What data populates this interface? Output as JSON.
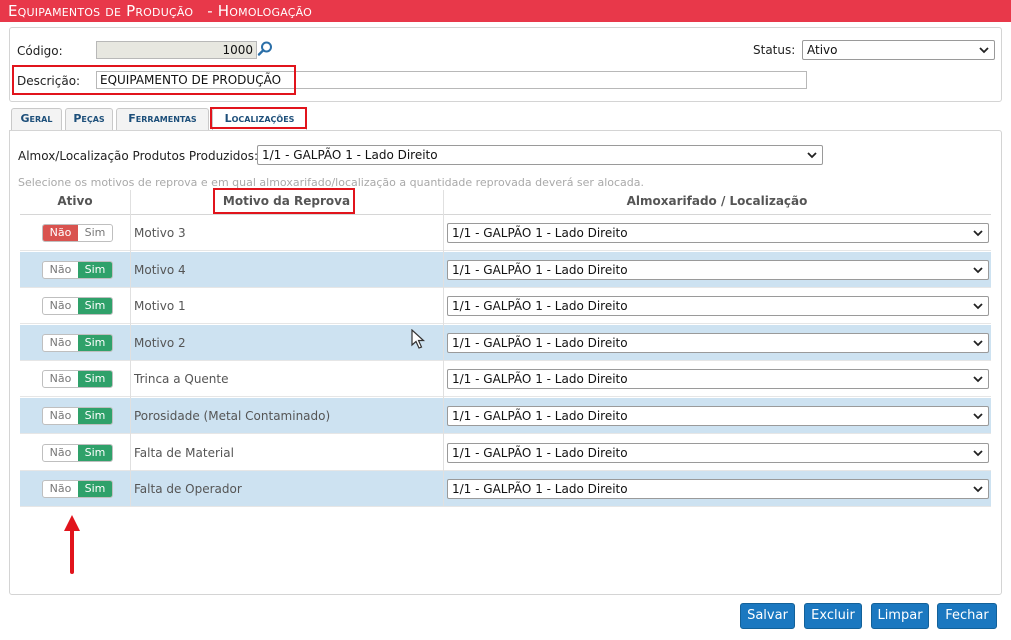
{
  "title": {
    "main": "Equipamentos de Produção",
    "sub": "- Homologação"
  },
  "form": {
    "codigo_label": "Código:",
    "codigo_value": "1000",
    "descricao_label": "Descrição:",
    "descricao_value": "EQUIPAMENTO DE PRODUÇÃO",
    "status_label": "Status:",
    "status_value": "Ativo"
  },
  "tabs": [
    {
      "label": "Geral",
      "active": false
    },
    {
      "label": "Peças",
      "active": false
    },
    {
      "label": "Ferramentas",
      "active": false
    },
    {
      "label": "Localizações",
      "active": true
    }
  ],
  "panel": {
    "almox_label": "Almox/Localização Produtos Produzidos:",
    "almox_value": "1/1 - GALPÃO 1 - Lado Direito",
    "hint": "Selecione os motivos de reprova e em qual almoxarifado/localização a quantidade reprovada deverá ser alocada."
  },
  "table": {
    "headers": {
      "ativo": "Ativo",
      "motivo": "Motivo da Reprova",
      "almox": "Almoxarifado / Localização"
    },
    "toggle_labels": {
      "nao": "Não",
      "sim": "Sim"
    },
    "rows": [
      {
        "ativo": "Não",
        "motivo": "Motivo 3",
        "local": "1/1 - GALPÃO 1 - Lado Direito"
      },
      {
        "ativo": "Sim",
        "motivo": "Motivo 4",
        "local": "1/1 - GALPÃO 1 - Lado Direito"
      },
      {
        "ativo": "Sim",
        "motivo": "Motivo 1",
        "local": "1/1 - GALPÃO 1 - Lado Direito"
      },
      {
        "ativo": "Sim",
        "motivo": "Motivo 2",
        "local": "1/1 - GALPÃO 1 - Lado Direito"
      },
      {
        "ativo": "Sim",
        "motivo": "Trinca a Quente",
        "local": "1/1 - GALPÃO 1 - Lado Direito"
      },
      {
        "ativo": "Sim",
        "motivo": "Porosidade (Metal Contaminado)",
        "local": "1/1 - GALPÃO 1 - Lado Direito"
      },
      {
        "ativo": "Sim",
        "motivo": "Falta de Material",
        "local": "1/1 - GALPÃO 1 - Lado Direito"
      },
      {
        "ativo": "Sim",
        "motivo": "Falta de Operador",
        "local": "1/1 - GALPÃO 1 - Lado Direito"
      }
    ]
  },
  "buttons": {
    "salvar": "Salvar",
    "excluir": "Excluir",
    "limpar": "Limpar",
    "fechar": "Fechar"
  },
  "colors": {
    "title_bar": "#e8384a",
    "highlight": "#e1141c",
    "button": "#1b78c0",
    "toggle_on": "#2fa16a",
    "toggle_off": "#d9534f",
    "row_alt": "#cde2f1"
  }
}
